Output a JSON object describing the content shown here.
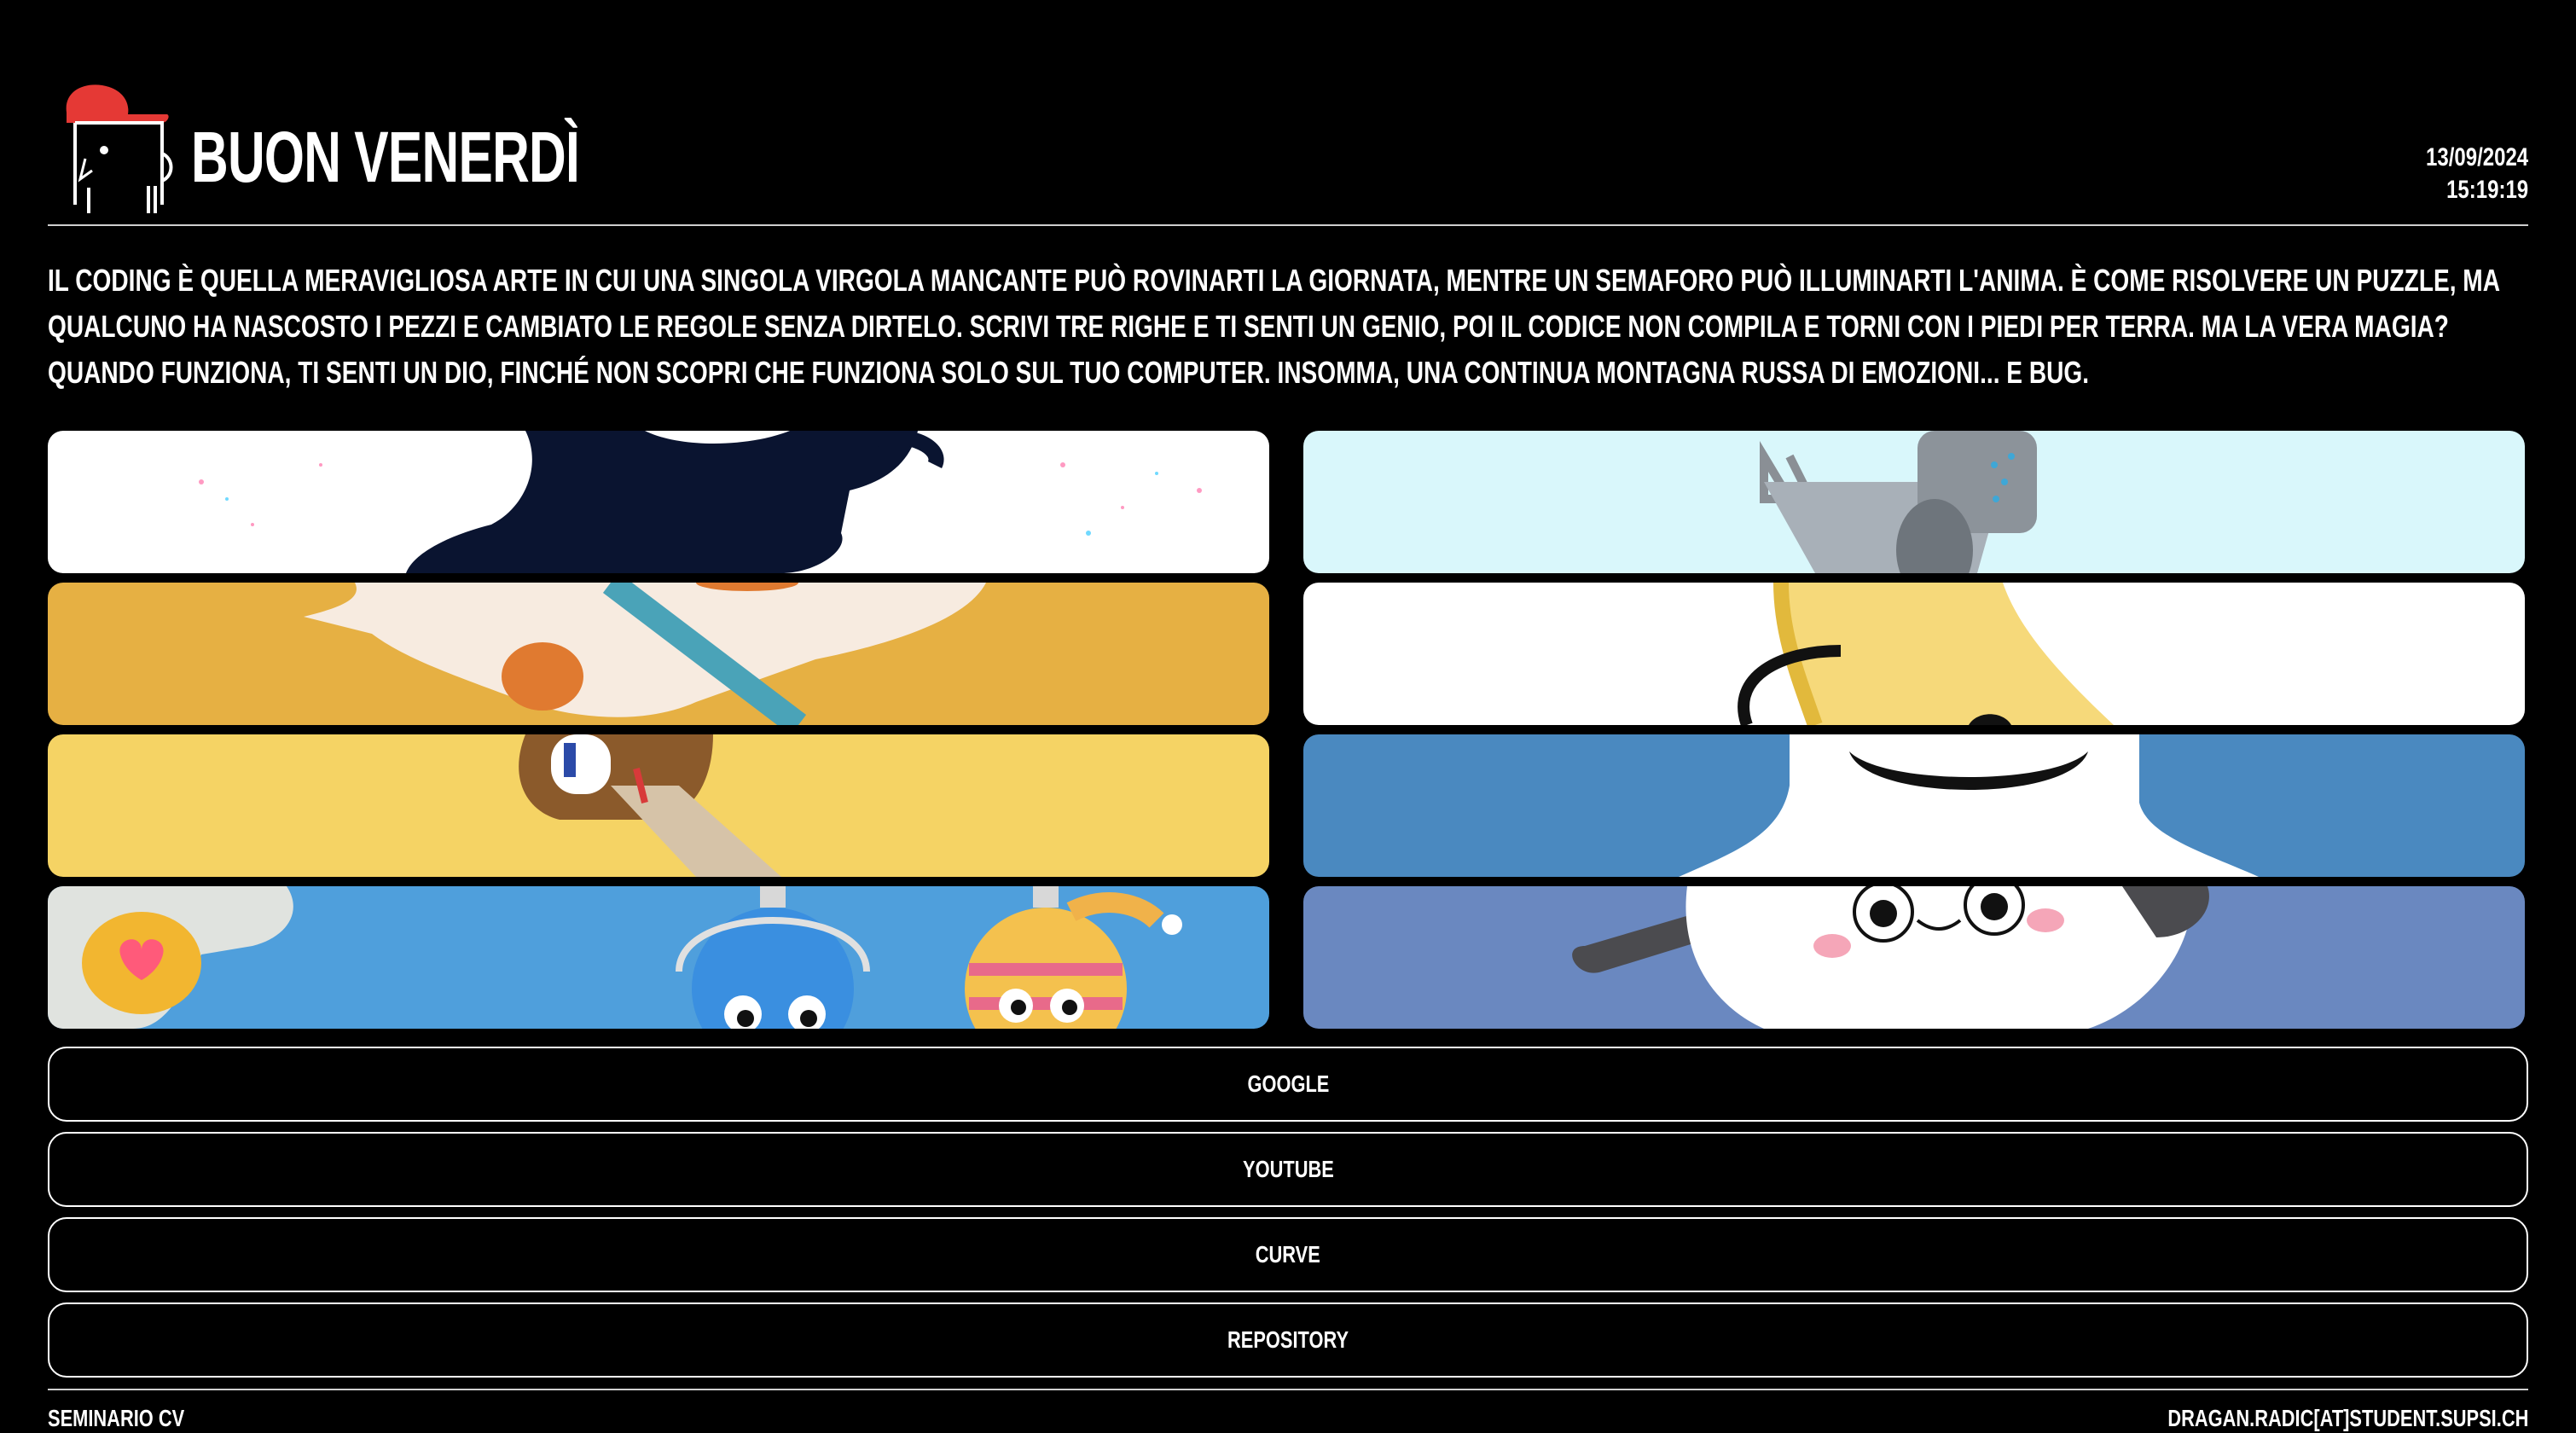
{
  "header": {
    "title": "Buon Venerdì",
    "date": "13/09/2024",
    "time": "15:19:19"
  },
  "intro": "Il coding è quella meravigliosa arte in cui una singola virgola mancante può rovinarti la giornata, mentre un semaforo può illuminarti l'anima. È come risolvere un puzzle, ma qualcuno ha nascosto i pezzi e cambiato le regole senza dirtelo. Scrivi tre righe e ti senti un genio, poi il codice non compila e torni con i piedi per terra. Ma la vera magia? Quando funziona, ti senti un dio, finché non scopri che funziona solo sul tuo computer. Insomma, una continua montagna russa di emozioni... e bug.",
  "gallery": {
    "left": [
      {
        "bg": "#ffffff"
      },
      {
        "bg": "#e6b043"
      },
      {
        "bg": "#f5d364"
      },
      {
        "bg": "#4f9fdc"
      }
    ],
    "right": [
      {
        "bg": "#d9f7fb"
      },
      {
        "bg": "#ffffff"
      },
      {
        "bg": "#4a89c0"
      },
      {
        "bg": "#6a88c0"
      }
    ]
  },
  "links": [
    {
      "label": "Google"
    },
    {
      "label": "YouTube"
    },
    {
      "label": "Curve"
    },
    {
      "label": "Repository"
    }
  ],
  "footer": {
    "left": "Seminario CV",
    "right": "dragan.radic[at]student.supsi.ch"
  },
  "colors": {
    "background": "#000000",
    "text": "#ffffff",
    "logo_cap": "#e53935"
  }
}
